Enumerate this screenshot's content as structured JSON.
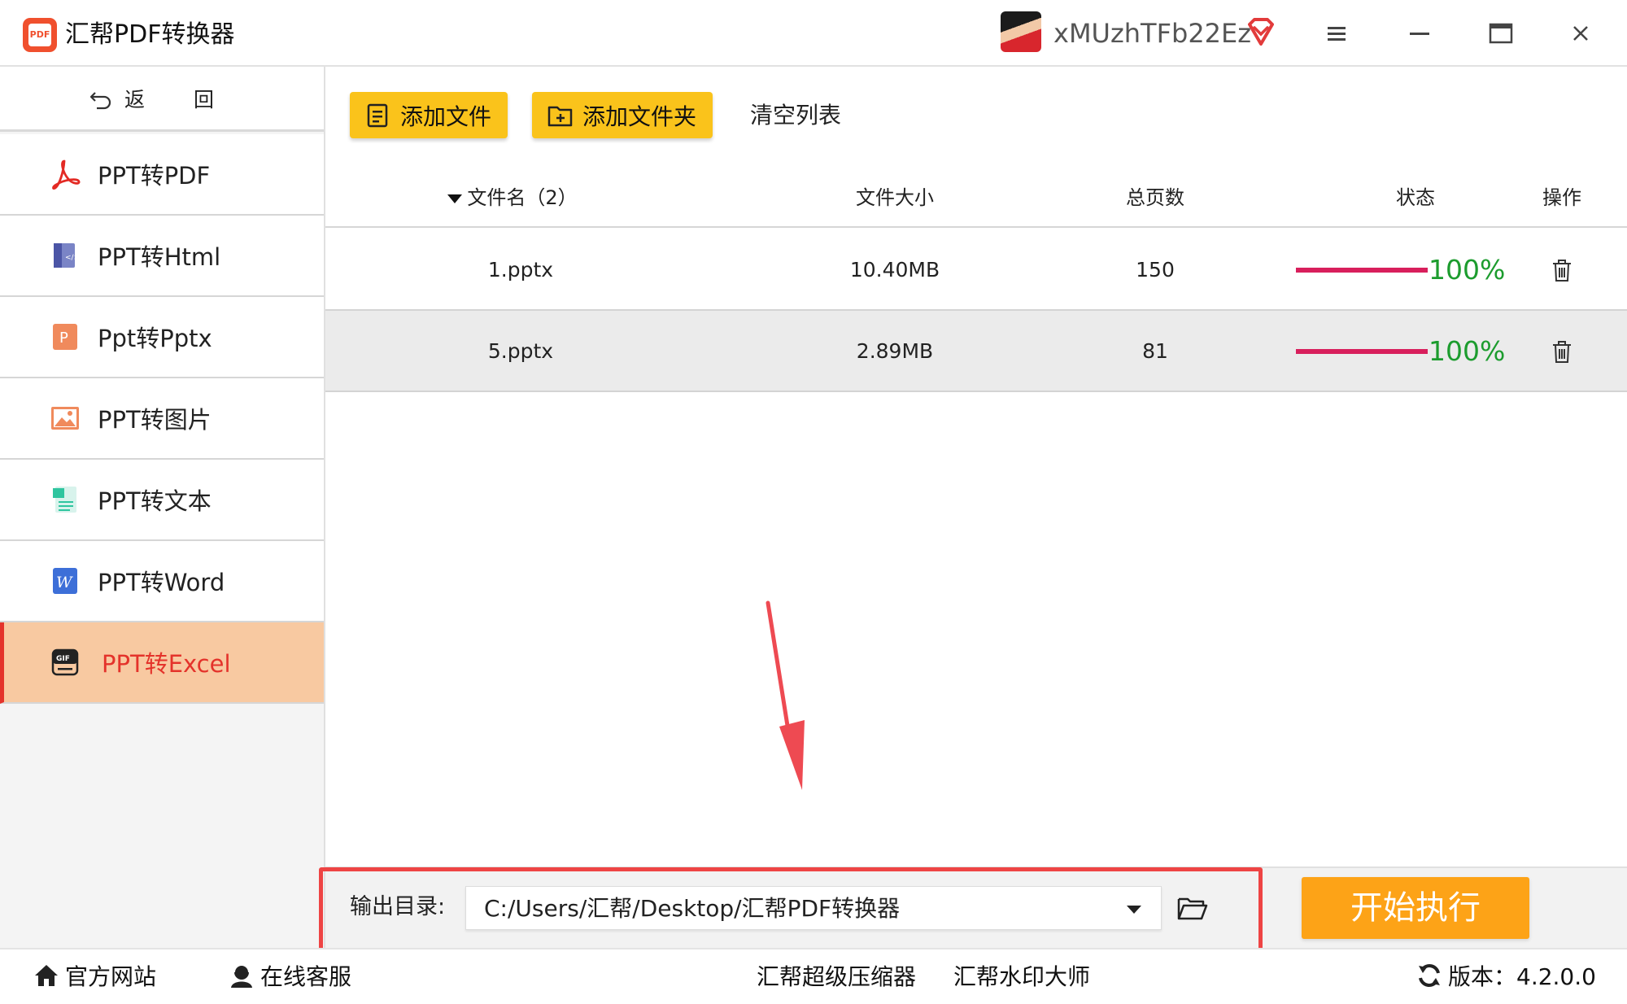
{
  "app": {
    "title": "汇帮PDF转换器",
    "username": "xMUzhTFb22Ez",
    "logo_text": "PDF"
  },
  "sidebar": {
    "back_label": "返 回",
    "items": [
      {
        "label": "PPT转PDF",
        "icon": "acrobat-icon"
      },
      {
        "label": "PPT转Html",
        "icon": "html-file-icon"
      },
      {
        "label": "Ppt转Pptx",
        "icon": "pptx-icon"
      },
      {
        "label": "PPT转图片",
        "icon": "image-icon"
      },
      {
        "label": "PPT转文本",
        "icon": "text-file-icon"
      },
      {
        "label": "PPT转Word",
        "icon": "word-icon"
      },
      {
        "label": "PPT转Excel",
        "icon": "gif-excel-icon",
        "active": true
      }
    ]
  },
  "toolbar": {
    "add_file": "添加文件",
    "add_folder": "添加文件夹",
    "clear_list": "清空列表"
  },
  "table": {
    "headers": {
      "name": "文件名（2）",
      "size": "文件大小",
      "pages": "总页数",
      "status": "状态",
      "action": "操作"
    },
    "rows": [
      {
        "name": "1.pptx",
        "size": "10.40MB",
        "pages": "150",
        "progress": "100%"
      },
      {
        "name": "5.pptx",
        "size": "2.89MB",
        "pages": "81",
        "progress": "100%"
      }
    ]
  },
  "output": {
    "label": "输出目录:",
    "path": "C:/Users/汇帮/Desktop/汇帮PDF转换器",
    "start_label": "开始执行"
  },
  "statusbar": {
    "website": "官方网站",
    "support": "在线客服",
    "compressor": "汇帮超级压缩器",
    "watermark": "汇帮水印大师",
    "version": "版本：4.2.0.0"
  },
  "colors": {
    "accent_yellow": "#fac31b",
    "start_orange": "#fda317",
    "active_bg": "#f8c9a1",
    "active_text": "#e4332b",
    "progress_bar": "#d81f5c",
    "progress_text": "#1c9c2e",
    "highlight_box": "#ee4444"
  }
}
